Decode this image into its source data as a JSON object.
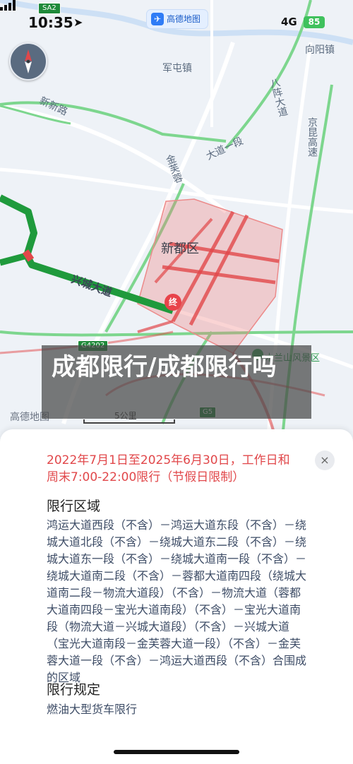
{
  "status_bar": {
    "time": "10:35",
    "app_pill_label": "高德地图",
    "network": "4G",
    "battery": "85"
  },
  "map": {
    "labels": {
      "town_juntun": "军屯镇",
      "town_xiangyang": "向阳镇",
      "road_xinxin": "新新路",
      "road_bawei": "八阵大道",
      "road_jinkun": "京昆高速",
      "road_datu": "大道一段",
      "road_jinbei": "金芙蓉",
      "road_xingcheng": "兴城大道",
      "district": "新都区",
      "end_marker": "终",
      "scenic": "木兰山风景区"
    },
    "shields": {
      "sa2": "SA2",
      "g4202": "G4202",
      "g5": "G5"
    },
    "brand": "高德地图",
    "scale_label": "5公里"
  },
  "overlay": {
    "title": "成都限行/成都限行吗"
  },
  "panel": {
    "header_text": "2022年7月1日至2025年6月30日，工作日和周末7:00-22:00限行（节假日限制）",
    "close_icon": "×",
    "sections": [
      {
        "title": "限行区域",
        "body": "鸿运大道西段（不含）－鸿运大道东段（不含）－绕城大道北段（不含）－绕城大道东二段（不含）－绕城大道东一段（不含）－绕城大道南一段（不含）－绕城大道南二段（不含）－蓉都大道南四段（绕城大道南二段－物流大道段）（不含）－物流大道（蓉都大道南四段－宝光大道南段）（不含）－宝光大道南段（物流大道－兴城大道段）（不含）－兴城大道（宝光大道南段－金芙蓉大道一段）（不含）－金芙蓉大道一段（不含）－鸿运大道西段（不含）合围成的区域"
      },
      {
        "title": "限行规定",
        "body": "燃油大型货车限行"
      }
    ]
  },
  "colors": {
    "restriction_red": "#e1474a",
    "route_green": "#1f9a3c",
    "highway_green": "#7dd68e"
  }
}
